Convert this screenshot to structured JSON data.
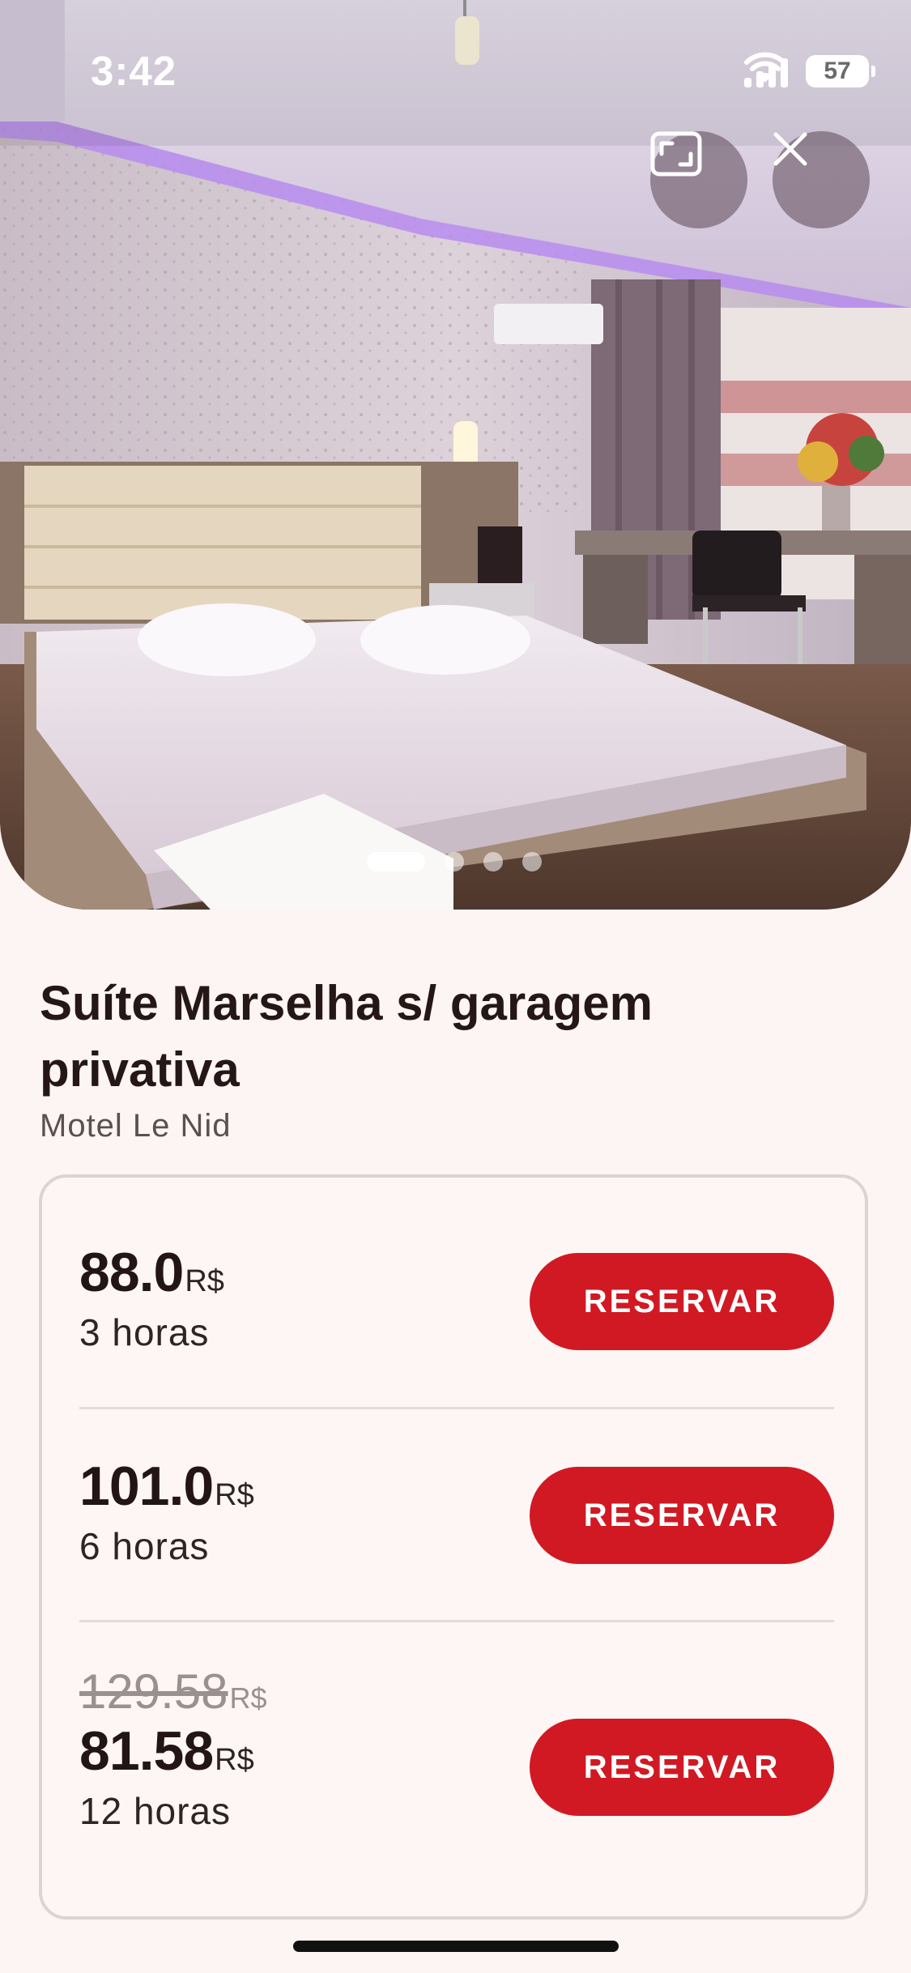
{
  "status_bar": {
    "time": "3:42",
    "battery": "57"
  },
  "hero": {
    "photo_alt": "Suíte com cama de casal, iluminação roxa",
    "expand_icon": "expand-icon",
    "close_icon": "close-icon",
    "carousel": {
      "total": 4,
      "active_index": 0
    }
  },
  "suite": {
    "title": "Suíte Marselha s/ garagem privativa",
    "motel": "Motel Le Nid"
  },
  "prices": [
    {
      "price": "88.0",
      "currency": "R$",
      "duration": "3 horas",
      "button": "RESERVAR"
    },
    {
      "price": "101.0",
      "currency": "R$",
      "duration": "6 horas",
      "button": "RESERVAR"
    },
    {
      "old_price": "129.58",
      "old_currency": "R$",
      "price": "81.58",
      "currency": "R$",
      "duration": "12 horas",
      "button": "RESERVAR"
    }
  ],
  "colors": {
    "accent": "#d11923",
    "background": "#fdf5f3",
    "text": "#261717"
  }
}
